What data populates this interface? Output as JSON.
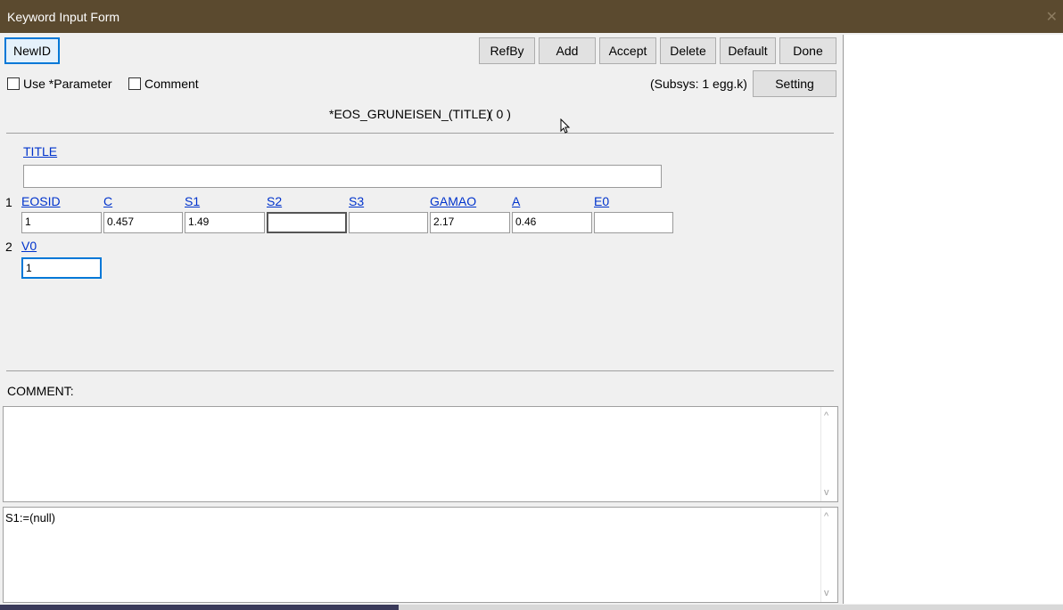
{
  "window": {
    "title": "Keyword Input Form"
  },
  "toolbar": {
    "newid": "NewID",
    "refby": "RefBy",
    "add": "Add",
    "accept": "Accept",
    "delete": "Delete",
    "default": "Default",
    "done": "Done",
    "setting": "Setting"
  },
  "options": {
    "use_parameter": "Use *Parameter",
    "comment": "Comment",
    "subsys": "(Subsys: 1 egg.k)"
  },
  "keyword": {
    "name": "*EOS_GRUNEISEN_(TITLE)",
    "count": "( 0 )"
  },
  "title_field": {
    "label": "TITLE",
    "value": ""
  },
  "row1": {
    "num": "1",
    "labels": [
      "EOSID",
      "C",
      "S1",
      "S2",
      "S3",
      "GAMAO",
      "A",
      "E0"
    ],
    "values": [
      "1",
      "0.457",
      "1.49",
      "",
      "",
      "2.17",
      "0.46",
      ""
    ]
  },
  "row2": {
    "num": "2",
    "label": "V0",
    "value": "1"
  },
  "comment_section": {
    "label": "COMMENT:",
    "text": ""
  },
  "status": {
    "text": "S1:=(null)"
  }
}
